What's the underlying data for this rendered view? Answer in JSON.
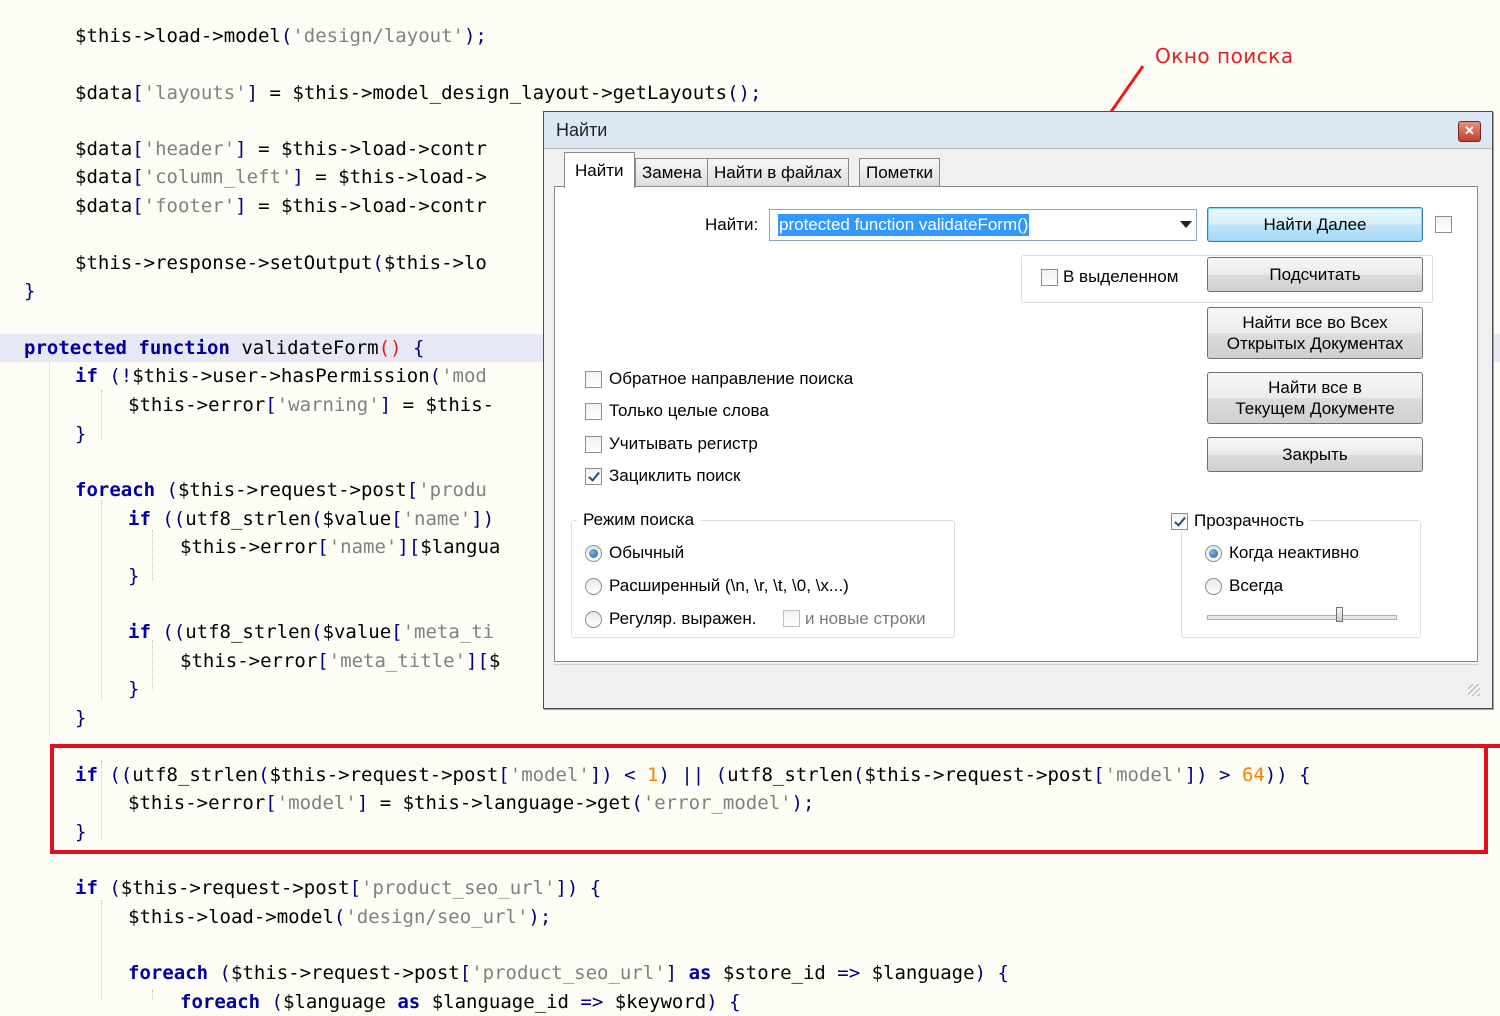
{
  "editor": {
    "lines": [
      [
        [
          "vr",
          "$this->load->model"
        ],
        [
          "op",
          "("
        ],
        [
          "st",
          "'design/layout'"
        ],
        [
          "op",
          ");"
        ]
      ],
      [],
      [
        [
          "vr",
          "$data"
        ],
        [
          "op",
          "["
        ],
        [
          "st",
          "'layouts'"
        ],
        [
          "op",
          "]"
        ],
        [
          "vr",
          " = $this->model_design_layout->getLayouts"
        ],
        [
          "op",
          "();"
        ]
      ],
      [],
      [
        [
          "vr",
          "$data"
        ],
        [
          "op",
          "["
        ],
        [
          "st",
          "'header'"
        ],
        [
          "op",
          "]"
        ],
        [
          "vr",
          " = $this->load->contr"
        ]
      ],
      [
        [
          "vr",
          "$data"
        ],
        [
          "op",
          "["
        ],
        [
          "st",
          "'column_left'"
        ],
        [
          "op",
          "]"
        ],
        [
          "vr",
          " = $this->load->"
        ]
      ],
      [
        [
          "vr",
          "$data"
        ],
        [
          "op",
          "["
        ],
        [
          "st",
          "'footer'"
        ],
        [
          "op",
          "]"
        ],
        [
          "vr",
          " = $this->load->contr"
        ]
      ],
      [],
      [
        [
          "vr",
          "$this->response->setOutput"
        ],
        [
          "op",
          "("
        ],
        [
          "vr",
          "$this->lo"
        ]
      ],
      [
        [
          "op",
          "}"
        ]
      ],
      [],
      [
        [
          "kw",
          "protected function"
        ],
        [
          "vr",
          " validateForm"
        ],
        [
          "br",
          "()"
        ],
        [
          "op",
          " {"
        ]
      ],
      [
        [
          "kw",
          "if"
        ],
        [
          "op",
          " (!"
        ],
        [
          "vr",
          "$this->user->hasPermission"
        ],
        [
          "op",
          "("
        ],
        [
          "st",
          "'mod"
        ]
      ],
      [
        [
          "vr",
          "$this->error"
        ],
        [
          "op",
          "["
        ],
        [
          "st",
          "'warning'"
        ],
        [
          "op",
          "]"
        ],
        [
          "vr",
          " = $this-"
        ]
      ],
      [
        [
          "op",
          "}"
        ]
      ],
      [],
      [
        [
          "kw",
          "foreach"
        ],
        [
          "op",
          " ("
        ],
        [
          "vr",
          "$this->request->post"
        ],
        [
          "op",
          "["
        ],
        [
          "st",
          "'produ"
        ]
      ],
      [
        [
          "kw",
          "if"
        ],
        [
          "op",
          " (("
        ],
        [
          "vr",
          "utf8_strlen"
        ],
        [
          "op",
          "("
        ],
        [
          "vr",
          "$value"
        ],
        [
          "op",
          "["
        ],
        [
          "st",
          "'name'"
        ],
        [
          "op",
          "])"
        ]
      ],
      [
        [
          "vr",
          "$this->error"
        ],
        [
          "op",
          "["
        ],
        [
          "st",
          "'name'"
        ],
        [
          "op",
          "]["
        ],
        [
          "vr",
          "$langua"
        ]
      ],
      [
        [
          "op",
          "}"
        ]
      ],
      [],
      [
        [
          "kw",
          "if"
        ],
        [
          "op",
          " (("
        ],
        [
          "vr",
          "utf8_strlen"
        ],
        [
          "op",
          "("
        ],
        [
          "vr",
          "$value"
        ],
        [
          "op",
          "["
        ],
        [
          "st",
          "'meta_ti"
        ]
      ],
      [
        [
          "vr",
          "$this->error"
        ],
        [
          "op",
          "["
        ],
        [
          "st",
          "'meta_title'"
        ],
        [
          "op",
          "]["
        ],
        [
          "vr",
          "$"
        ]
      ],
      [
        [
          "op",
          "}"
        ]
      ],
      [
        [
          "op",
          "}"
        ]
      ],
      [],
      [
        [
          "kw",
          "if"
        ],
        [
          "op",
          " (("
        ],
        [
          "vr",
          "utf8_strlen"
        ],
        [
          "op",
          "("
        ],
        [
          "vr",
          "$this->request->post"
        ],
        [
          "op",
          "["
        ],
        [
          "st",
          "'model'"
        ],
        [
          "op",
          "]) < "
        ],
        [
          "nm",
          "1"
        ],
        [
          "op",
          ") || ("
        ],
        [
          "vr",
          "utf8_strlen"
        ],
        [
          "op",
          "("
        ],
        [
          "vr",
          "$this->request->post"
        ],
        [
          "op",
          "["
        ],
        [
          "st",
          "'model'"
        ],
        [
          "op",
          "]) > "
        ],
        [
          "nm",
          "64"
        ],
        [
          "op",
          ")) {"
        ]
      ],
      [
        [
          "vr",
          "$this->error"
        ],
        [
          "op",
          "["
        ],
        [
          "st",
          "'model'"
        ],
        [
          "op",
          "]"
        ],
        [
          "vr",
          " = $this->language->get"
        ],
        [
          "op",
          "("
        ],
        [
          "st",
          "'error_model'"
        ],
        [
          "op",
          ");"
        ]
      ],
      [
        [
          "op",
          "}"
        ]
      ],
      [],
      [
        [
          "kw",
          "if"
        ],
        [
          "op",
          " ("
        ],
        [
          "vr",
          "$this->request->post"
        ],
        [
          "op",
          "["
        ],
        [
          "st",
          "'product_seo_url'"
        ],
        [
          "op",
          "]) {"
        ]
      ],
      [
        [
          "vr",
          "$this->load->model"
        ],
        [
          "op",
          "("
        ],
        [
          "st",
          "'design/seo_url'"
        ],
        [
          "op",
          ");"
        ]
      ],
      [],
      [
        [
          "kw",
          "foreach"
        ],
        [
          "op",
          " ("
        ],
        [
          "vr",
          "$this->request->post"
        ],
        [
          "op",
          "["
        ],
        [
          "st",
          "'product_seo_url'"
        ],
        [
          "op",
          "] "
        ],
        [
          "kw",
          "as"
        ],
        [
          "vr",
          " $store_id"
        ],
        [
          "op",
          " => "
        ],
        [
          "vr",
          "$language"
        ],
        [
          "op",
          ") {"
        ]
      ],
      [
        [
          "kw",
          "foreach"
        ],
        [
          "op",
          " ("
        ],
        [
          "vr",
          "$language"
        ],
        [
          "kw",
          " as"
        ],
        [
          "vr",
          " $language_id"
        ],
        [
          "op",
          " => "
        ],
        [
          "vr",
          "$keyword"
        ],
        [
          "op",
          ") {"
        ]
      ]
    ]
  },
  "annotation": {
    "label": "Окно поиска",
    "color": "#e02020"
  },
  "dialog": {
    "title": "Найти",
    "close_label": "✕",
    "tabs": [
      "Найти",
      "Замена",
      "Найти в файлах",
      "Пометки"
    ],
    "active_tab": 0,
    "find_label": "Найти:",
    "find_value": "protected function validateForm()",
    "in_selection": {
      "label": "В выделенном",
      "checked": false
    },
    "buttons": {
      "find_next": "Найти Далее",
      "count": "Подсчитать",
      "find_all_open_l1": "Найти все во Всех",
      "find_all_open_l2": "Открытых Документах",
      "find_all_current_l1": "Найти все в",
      "find_all_current_l2": "Текущем Документе",
      "close": "Закрыть"
    },
    "options": [
      {
        "label": "Обратное направление поиска",
        "checked": false
      },
      {
        "label": "Только целые слова",
        "checked": false
      },
      {
        "label": "Учитывать регистр",
        "checked": false
      },
      {
        "label": "Зациклить поиск",
        "checked": true
      }
    ],
    "search_mode": {
      "title": "Режим поиска",
      "normal": "Обычный",
      "extended": "Расширенный (\\n, \\r, \\t, \\0, \\x...)",
      "regex": "Регуляр. выражен.",
      "newlines": "и новые строки",
      "selected": "normal"
    },
    "transparency": {
      "label": "Прозрачность",
      "checked": true,
      "when_inactive": "Когда неактивно",
      "always": "Всегда",
      "selected": "when_inactive",
      "level": 0.7
    }
  }
}
